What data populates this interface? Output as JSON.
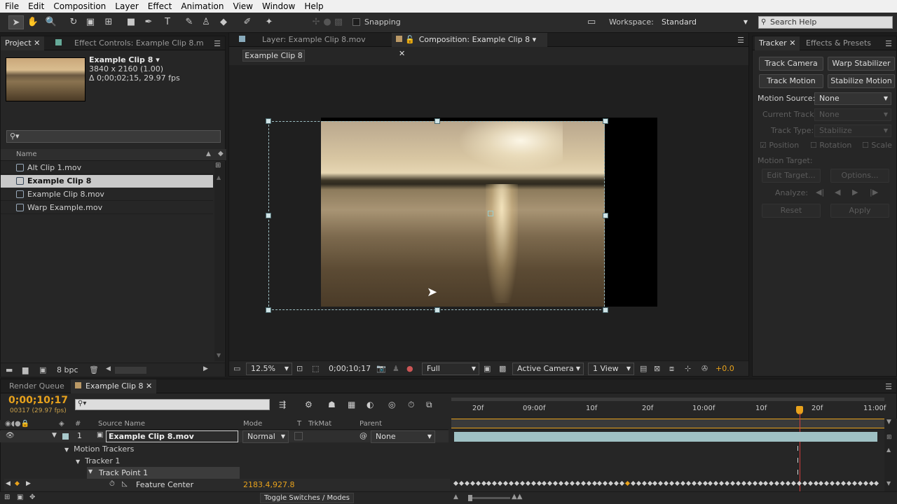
{
  "menu": [
    "File",
    "Edit",
    "Composition",
    "Layer",
    "Effect",
    "Animation",
    "View",
    "Window",
    "Help"
  ],
  "toolbar": {
    "snapping": "Snapping",
    "workspace_label": "Workspace:",
    "workspace_value": "Standard",
    "search_placeholder": "Search Help"
  },
  "project": {
    "tab_project": "Project",
    "tab_effects": "Effect Controls: Example Clip 8.m",
    "item_name": "Example Clip 8 ▾",
    "item_dims": "3840 x 2160 (1.00)",
    "item_duration": "Δ 0;00;02;15, 29.97 fps",
    "column_name": "Name",
    "files": [
      "Alt Clip 1.mov",
      "Example Clip 8",
      "Example Clip 8.mov",
      "Warp Example.mov"
    ],
    "bpc": "8 bpc"
  },
  "viewer": {
    "tab_layer": "Layer: Example Clip 8.mov",
    "tab_comp": "Composition: Example Clip 8",
    "comp_button": "Example Clip 8",
    "zoom": "12.5%",
    "timecode": "0;00;10;17",
    "resolution": "Full",
    "camera": "Active Camera",
    "views": "1 View",
    "exposure": "+0.0"
  },
  "tracker": {
    "tab_tracker": "Tracker",
    "tab_effects": "Effects & Presets",
    "track_camera": "Track Camera",
    "warp_stabilizer": "Warp Stabilizer",
    "track_motion": "Track Motion",
    "stabilize_motion": "Stabilize Motion",
    "motion_source_label": "Motion Source:",
    "motion_source_value": "None",
    "current_track_label": "Current Track:",
    "current_track_value": "None",
    "track_type_label": "Track Type:",
    "track_type_value": "Stabilize",
    "position": "Position",
    "rotation": "Rotation",
    "scale": "Scale",
    "motion_target_label": "Motion Target:",
    "edit_target": "Edit Target...",
    "options": "Options...",
    "analyze_label": "Analyze:",
    "reset": "Reset",
    "apply": "Apply"
  },
  "timeline": {
    "tab_render": "Render Queue",
    "tab_comp": "Example Clip 8",
    "timecode": "0;00;10;17",
    "frames": "00317 (29.97 fps)",
    "col_number": "#",
    "col_source": "Source Name",
    "col_mode": "Mode",
    "col_t": "T",
    "col_trkmat": "TrkMat",
    "col_parent": "Parent",
    "layer_number": "1",
    "layer_name": "Example Clip 8.mov",
    "layer_mode": "Normal",
    "layer_parent": "None",
    "motion_trackers": "Motion Trackers",
    "tracker1": "Tracker 1",
    "track_point": "Track Point 1",
    "feature_center": "Feature Center",
    "feature_value": "2183.4,927.8",
    "toggle": "Toggle Switches / Modes",
    "ruler": [
      "20f",
      "09:00f",
      "10f",
      "20f",
      "10:00f",
      "10f",
      "20f",
      "11:00f"
    ]
  },
  "colors": {
    "accent": "#e8a21c",
    "teal": "#a8c9cc",
    "playhead": "#d33c3c"
  }
}
